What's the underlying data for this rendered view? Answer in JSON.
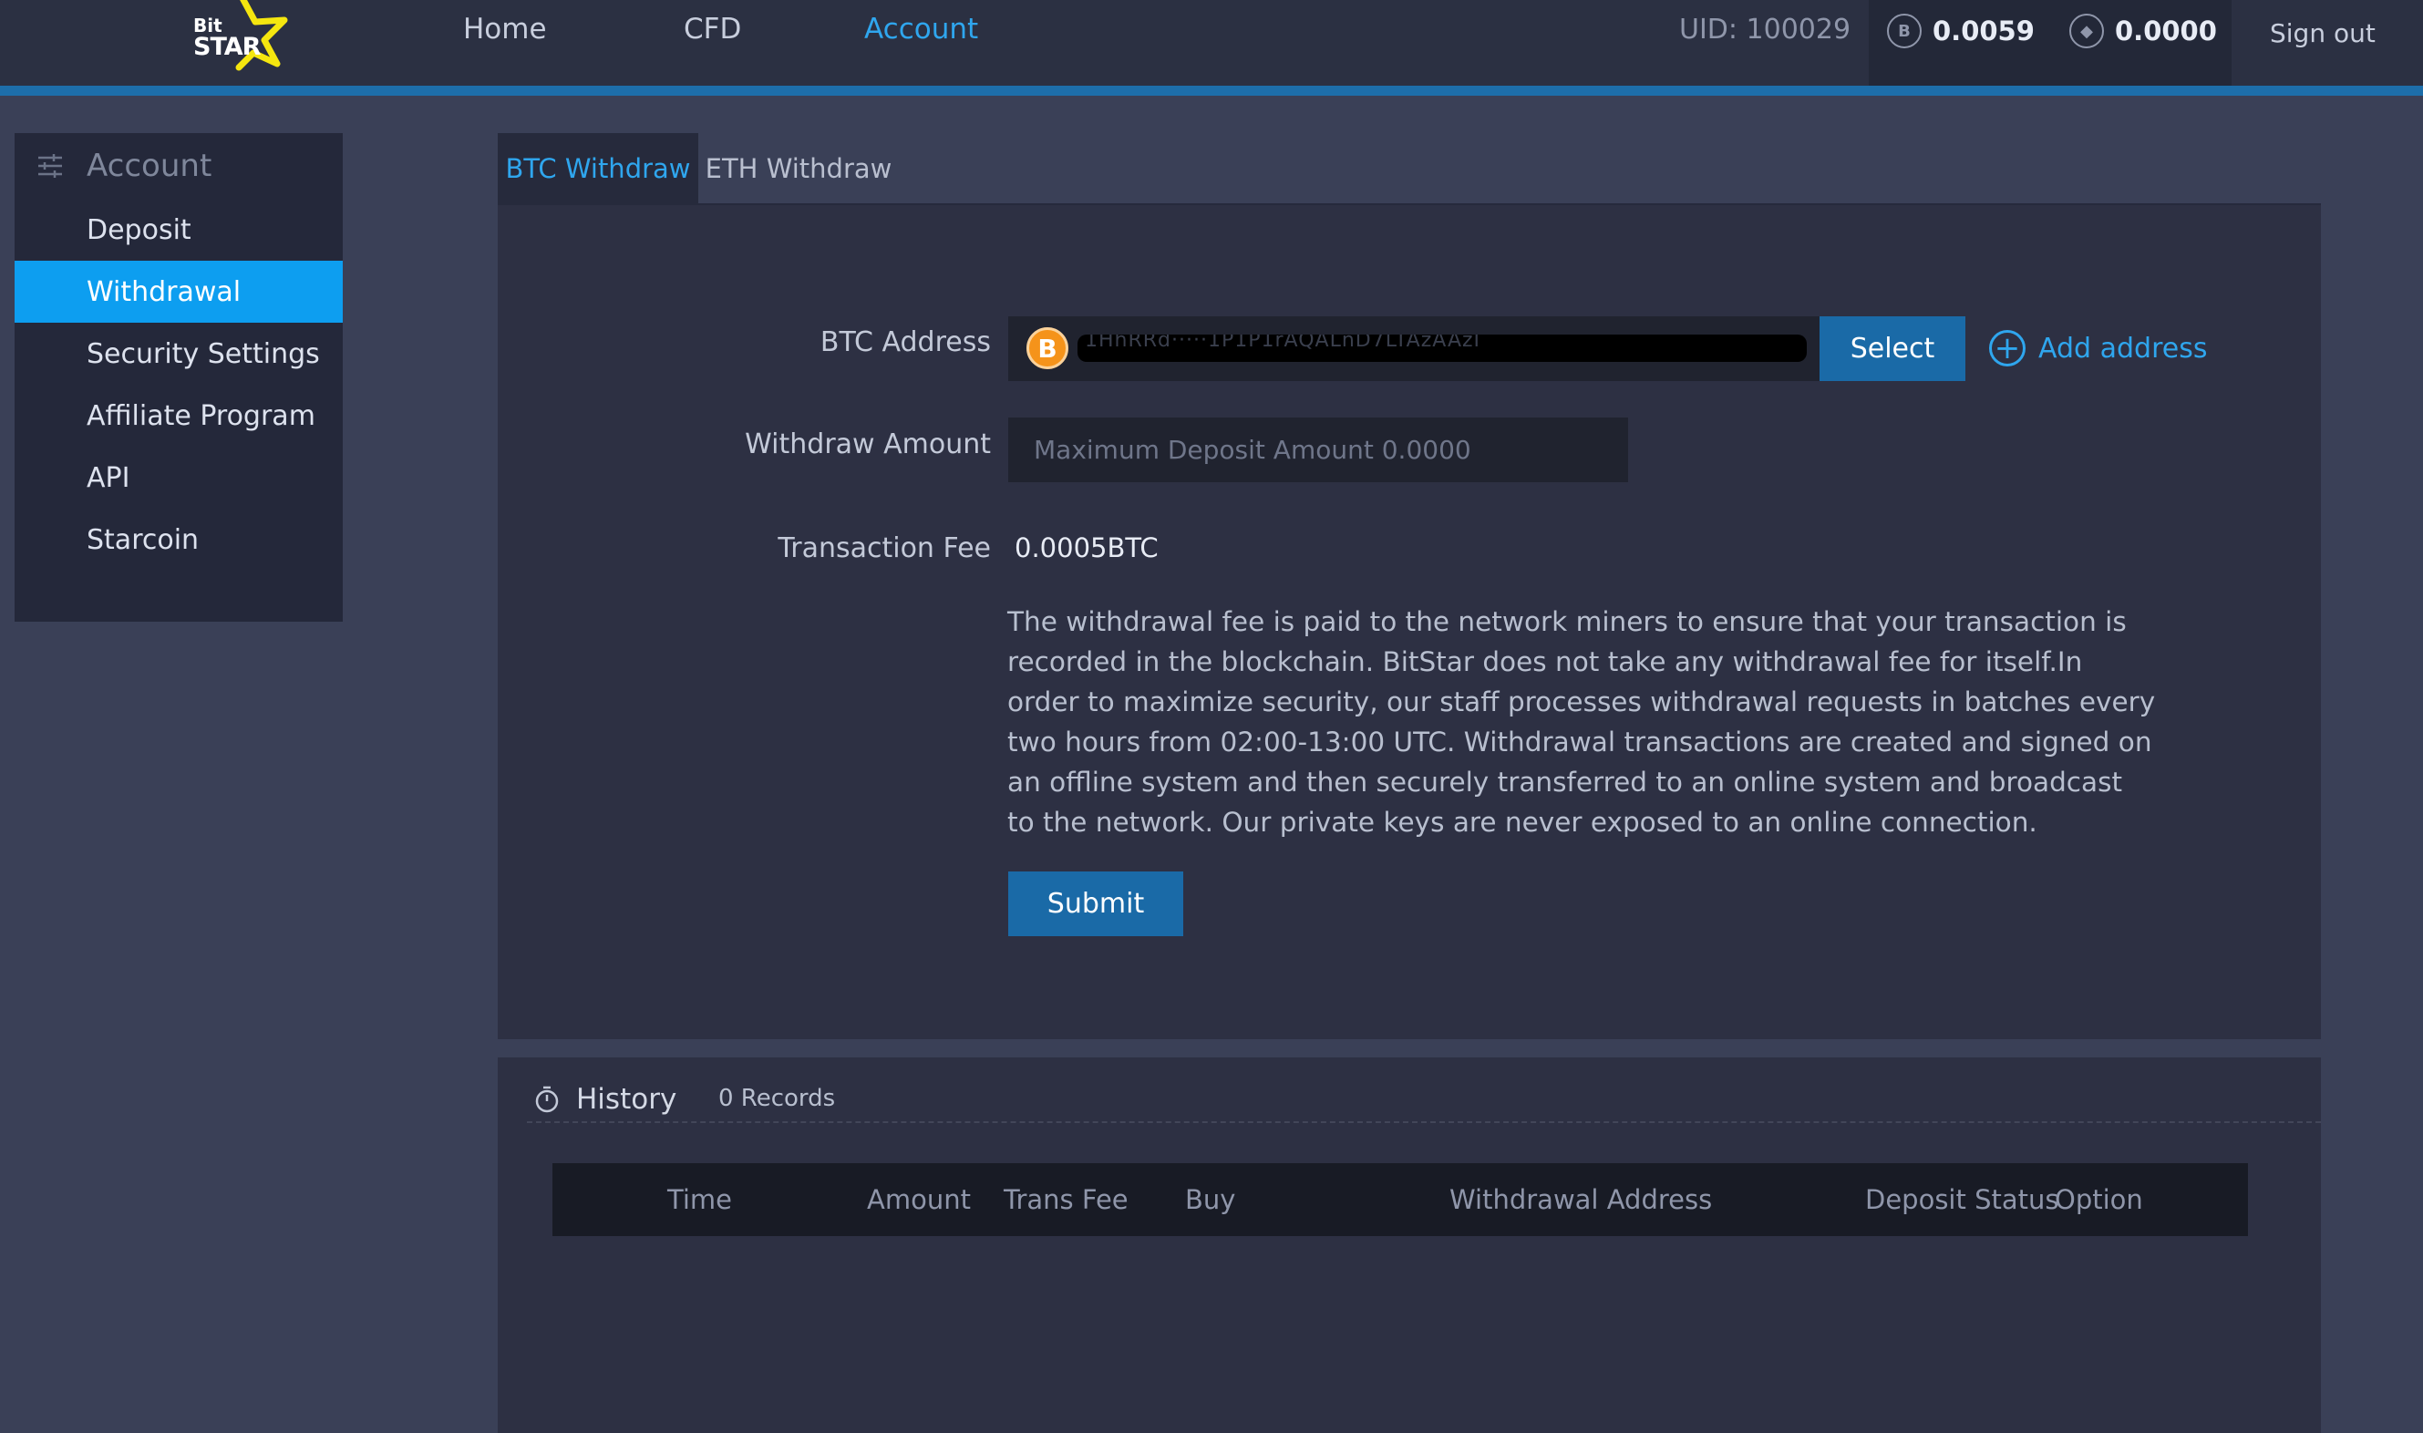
{
  "brand": {
    "logo_top": "Bit",
    "logo_bottom": "STAR"
  },
  "nav": {
    "items": [
      {
        "label": "Home",
        "active": false
      },
      {
        "label": "CFD",
        "active": false
      },
      {
        "label": "Account",
        "active": true
      }
    ]
  },
  "header": {
    "uid_label": "UID: 100029",
    "balances": [
      {
        "icon": "bitcoin-icon",
        "glyph": "B",
        "value": "0.0059"
      },
      {
        "icon": "ethereum-icon",
        "glyph": "◆",
        "value": "0.0000"
      }
    ],
    "sign_out": "Sign out"
  },
  "sidebar": {
    "title": "Account",
    "items": [
      {
        "label": "Deposit"
      },
      {
        "label": "Withdrawal"
      },
      {
        "label": "Security Settings"
      },
      {
        "label": "Affiliate Program"
      },
      {
        "label": "API"
      },
      {
        "label": "Starcoin"
      }
    ],
    "active_index": 1
  },
  "tabs": [
    {
      "label": "BTC Withdraw",
      "active": true
    },
    {
      "label": "ETH Withdraw",
      "active": false
    }
  ],
  "form": {
    "btc_address_label": "BTC Address",
    "btc_address_value": "1HhRRd·····1P1P1rAQALnD7LTAzAAzI",
    "select_label": "Select",
    "add_address_label": "Add address",
    "withdraw_amount_label": "Withdraw Amount",
    "withdraw_amount_placeholder": "Maximum Deposit Amount 0.0000",
    "transaction_fee_label": "Transaction Fee",
    "transaction_fee_value": "0.0005BTC",
    "description": "The withdrawal fee is paid to the network miners to ensure that your transaction is recorded in the blockchain. BitStar does not take any withdrawal fee for itself.In order to maximize security, our staff processes withdrawal requests in batches every two hours from 02:00-13:00 UTC. Withdrawal transactions are created and signed on an offline system and then securely transferred to an online system and broadcast to the network. Our private keys are never exposed to an online connection.",
    "submit_label": "Submit"
  },
  "history": {
    "title": "History",
    "records_label": "0 Records",
    "columns": [
      "Time",
      "Amount",
      "Trans Fee",
      "Buy",
      "Withdrawal Address",
      "Deposit Status",
      "Option"
    ],
    "rows": []
  },
  "colors": {
    "accent": "#0d9ef0",
    "link": "#2fa6ee",
    "button": "#1a6aa7",
    "topbar": "#2b3042",
    "page_bg": "#3a4057",
    "panel": "#2d3043",
    "logo_star": "#f5e60f"
  }
}
